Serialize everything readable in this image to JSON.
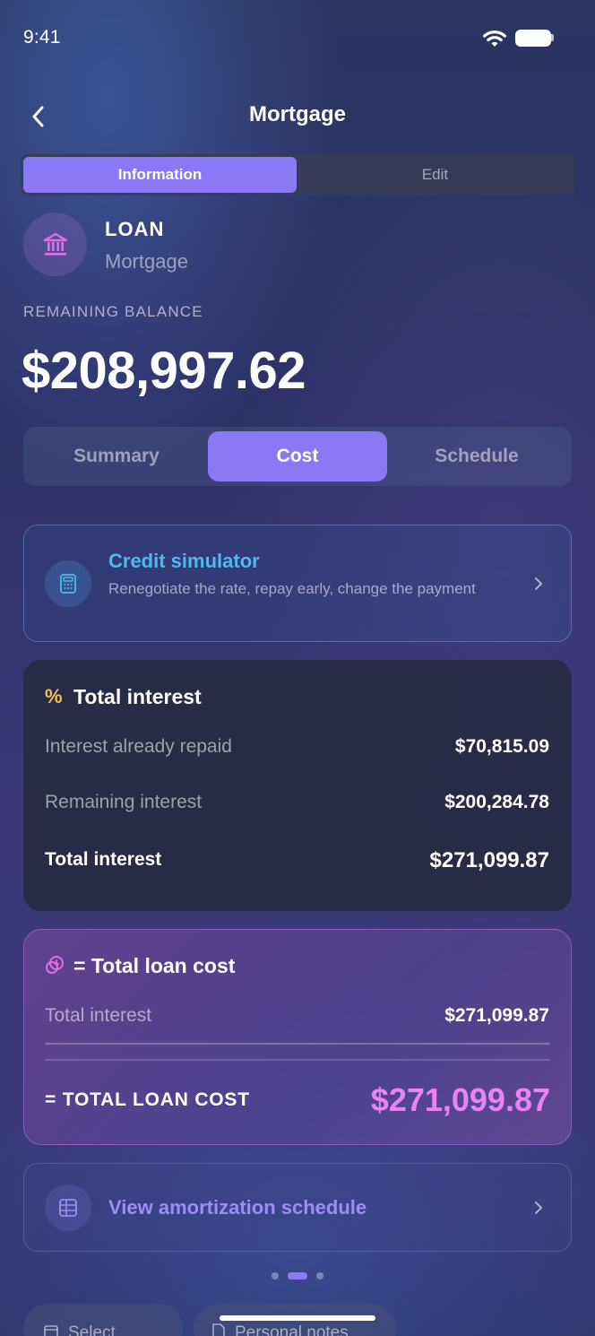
{
  "status": {
    "time": "9:41"
  },
  "nav": {
    "title": "Mortgage",
    "back_icon": "chevron-left-icon"
  },
  "mode_tabs": {
    "active": "Information",
    "inactive": "Edit"
  },
  "loan": {
    "type": "LOAN",
    "name": "Mortgage",
    "icon": "bank-icon"
  },
  "balance": {
    "label": "REMAINING BALANCE",
    "value": "$208,997.62"
  },
  "tabs": [
    {
      "label": "Summary"
    },
    {
      "label": "Cost"
    },
    {
      "label": "Schedule"
    }
  ],
  "simulator": {
    "title": "Credit simulator",
    "description": "Renegotiate the rate, repay early, change the payment",
    "icon": "calculator-icon"
  },
  "interest": {
    "icon_glyph": "%",
    "title": "Total interest",
    "rows": [
      {
        "label": "Interest already repaid",
        "value": "$70,815.09"
      },
      {
        "label": "Remaining interest",
        "value": "$200,284.78"
      },
      {
        "label": "Total interest",
        "value": "$271,099.87"
      }
    ]
  },
  "loan_cost": {
    "title": "= Total loan cost",
    "row": {
      "label": "Total interest",
      "value": "$271,099.87"
    },
    "final_label": "= TOTAL LOAN COST",
    "final_value": "$271,099.87",
    "accent": "#ea82f2"
  },
  "amortization": {
    "label": "View amortization schedule",
    "icon": "table-icon"
  },
  "pager": {
    "pages": 3,
    "current": 2
  },
  "bottom": {
    "select_label": "Select",
    "notes_label": "Personal notes"
  },
  "colors": {
    "accent": "#8b78f5",
    "simulator_title": "#4fb8ee",
    "percent_icon": "#f2c24d"
  }
}
